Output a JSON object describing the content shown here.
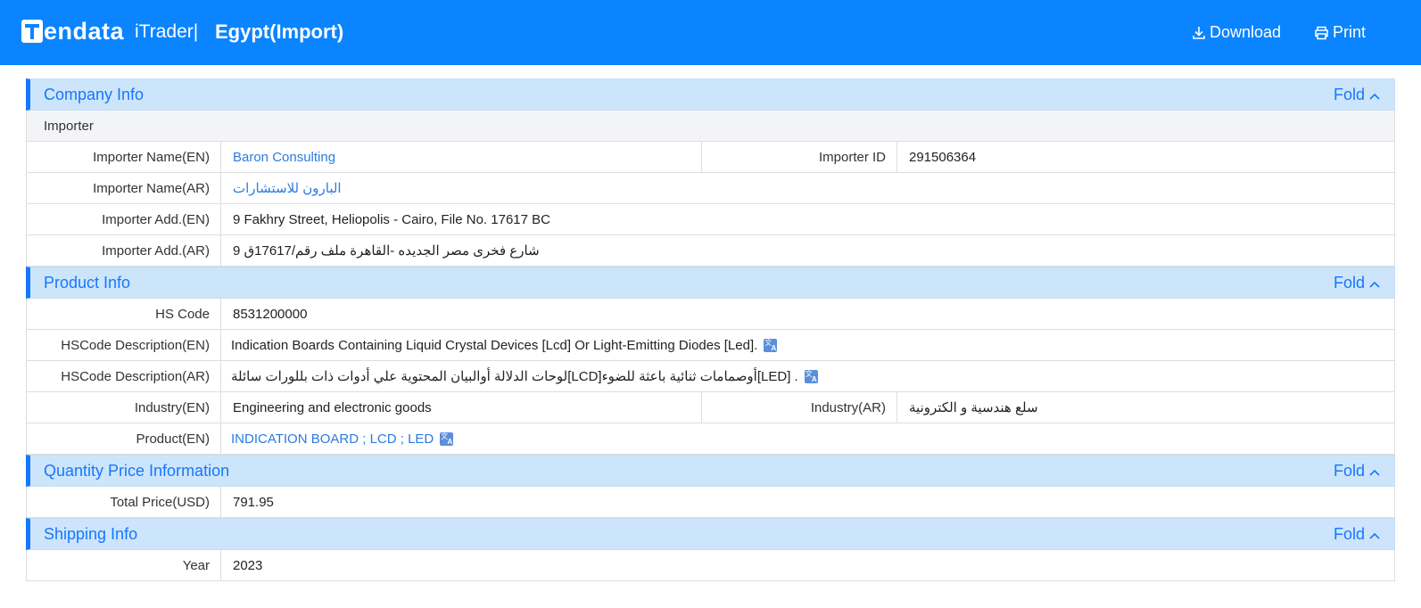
{
  "header": {
    "logo_text": "endata",
    "itrader": "iTrader|",
    "title": "Egypt(Import)",
    "download_label": "Download",
    "print_label": "Print"
  },
  "fold_label": "Fold",
  "company": {
    "title": "Company Info",
    "subheader": "Importer",
    "importer_name_en_label": "Importer Name(EN)",
    "importer_name_en": "Baron Consulting",
    "importer_id_label": "Importer ID",
    "importer_id": "291506364",
    "importer_name_ar_label": "Importer Name(AR)",
    "importer_name_ar": "البارون للاستشارات",
    "importer_add_en_label": "Importer Add.(EN)",
    "importer_add_en": "9 Fakhry Street, Heliopolis - Cairo, File No. 17617 BC",
    "importer_add_ar_label": "Importer Add.(AR)",
    "importer_add_ar": "9 شارع فخرى مصر الجديده -القاهرة ملف رقم/17617ق"
  },
  "product": {
    "title": "Product Info",
    "hs_code_label": "HS Code",
    "hs_code": "8531200000",
    "hs_desc_en_label": "HSCode Description(EN)",
    "hs_desc_en": "Indication Boards Containing Liquid Crystal Devices [Lcd] Or Light-Emitting Diodes [Led].",
    "hs_desc_ar_label": "HSCode Description(AR)",
    "hs_desc_ar": "لوحات الدلالة أوالبيان المحتوية علي أدوات ذات بللورات سائلة[LCD]أوصمامات ثنائية باعثة للضوء[LED] .",
    "industry_en_label": "Industry(EN)",
    "industry_en": "Engineering and electronic goods",
    "industry_ar_label": "Industry(AR)",
    "industry_ar": "سلع هندسية و الكترونية",
    "product_en_label": "Product(EN)",
    "product_en": "INDICATION BOARD ; LCD ; LED"
  },
  "quantity": {
    "title": "Quantity Price Information",
    "total_price_label": "Total Price(USD)",
    "total_price": "791.95"
  },
  "shipping": {
    "title": "Shipping Info",
    "year_label": "Year",
    "year": "2023"
  },
  "icons": {
    "download": "download-icon",
    "print": "printer-icon",
    "fold": "chevron-up-icon",
    "translate": "translate-icon"
  },
  "colors": {
    "header_bg": "#0a84ff",
    "section_bg": "#cde5fb",
    "accent": "#1677ff",
    "link": "#2b7be0"
  }
}
